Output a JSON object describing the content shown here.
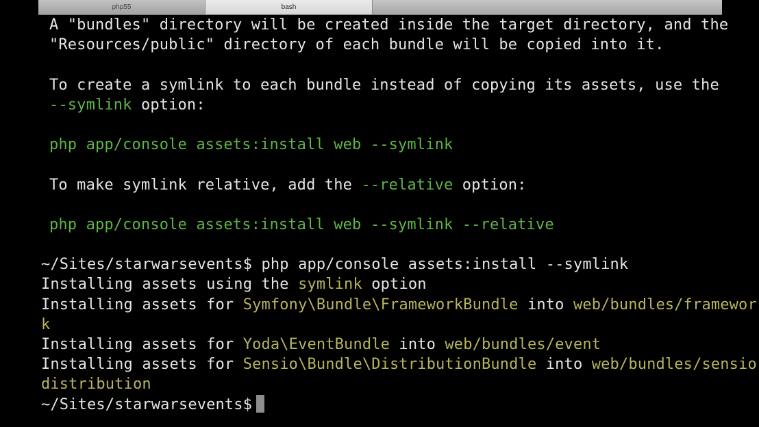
{
  "tabs": [
    {
      "label": "php55",
      "active": false
    },
    {
      "label": "bash",
      "active": true
    }
  ],
  "colors": {
    "background": "#000000",
    "text": "#e4e4e4",
    "green": "#5fb446",
    "yellow": "#b7b45d"
  },
  "help": {
    "line1": "A \"bundles\" directory will be created inside the target directory, and the",
    "line2": "\"Resources/public\" directory of each bundle will be copied into it.",
    "line3": "To create a symlink to each bundle instead of copying its assets, use the",
    "line4_opt": "--symlink",
    "line4_rest": " option:",
    "line5": "php app/console assets:install web --symlink",
    "line6_pre": "To make symlink relative, add the ",
    "line6_opt": "--relative",
    "line6_post": " option:",
    "line7": "php app/console assets:install web --symlink --relative"
  },
  "output": {
    "prompt": "~/Sites/starwarsevents$",
    "command": " php app/console assets:install --symlink",
    "using_pre": "Installing assets using the ",
    "using_mode": "symlink",
    "using_post": " option",
    "ifor": "Installing assets for ",
    "into": " into ",
    "b1_name": "Symfony\\Bundle\\FrameworkBundle",
    "b1_path": "web/bundles/framewor",
    "b1_path_cont": "k",
    "b2_name": "Yoda\\EventBundle",
    "b2_path": "web/bundles/event",
    "b3_name": "Sensio\\Bundle\\DistributionBundle",
    "b3_path": "web/bundles/sensio",
    "b3_path_cont": "distribution",
    "final_prompt": "~/Sites/starwarsevents$"
  }
}
